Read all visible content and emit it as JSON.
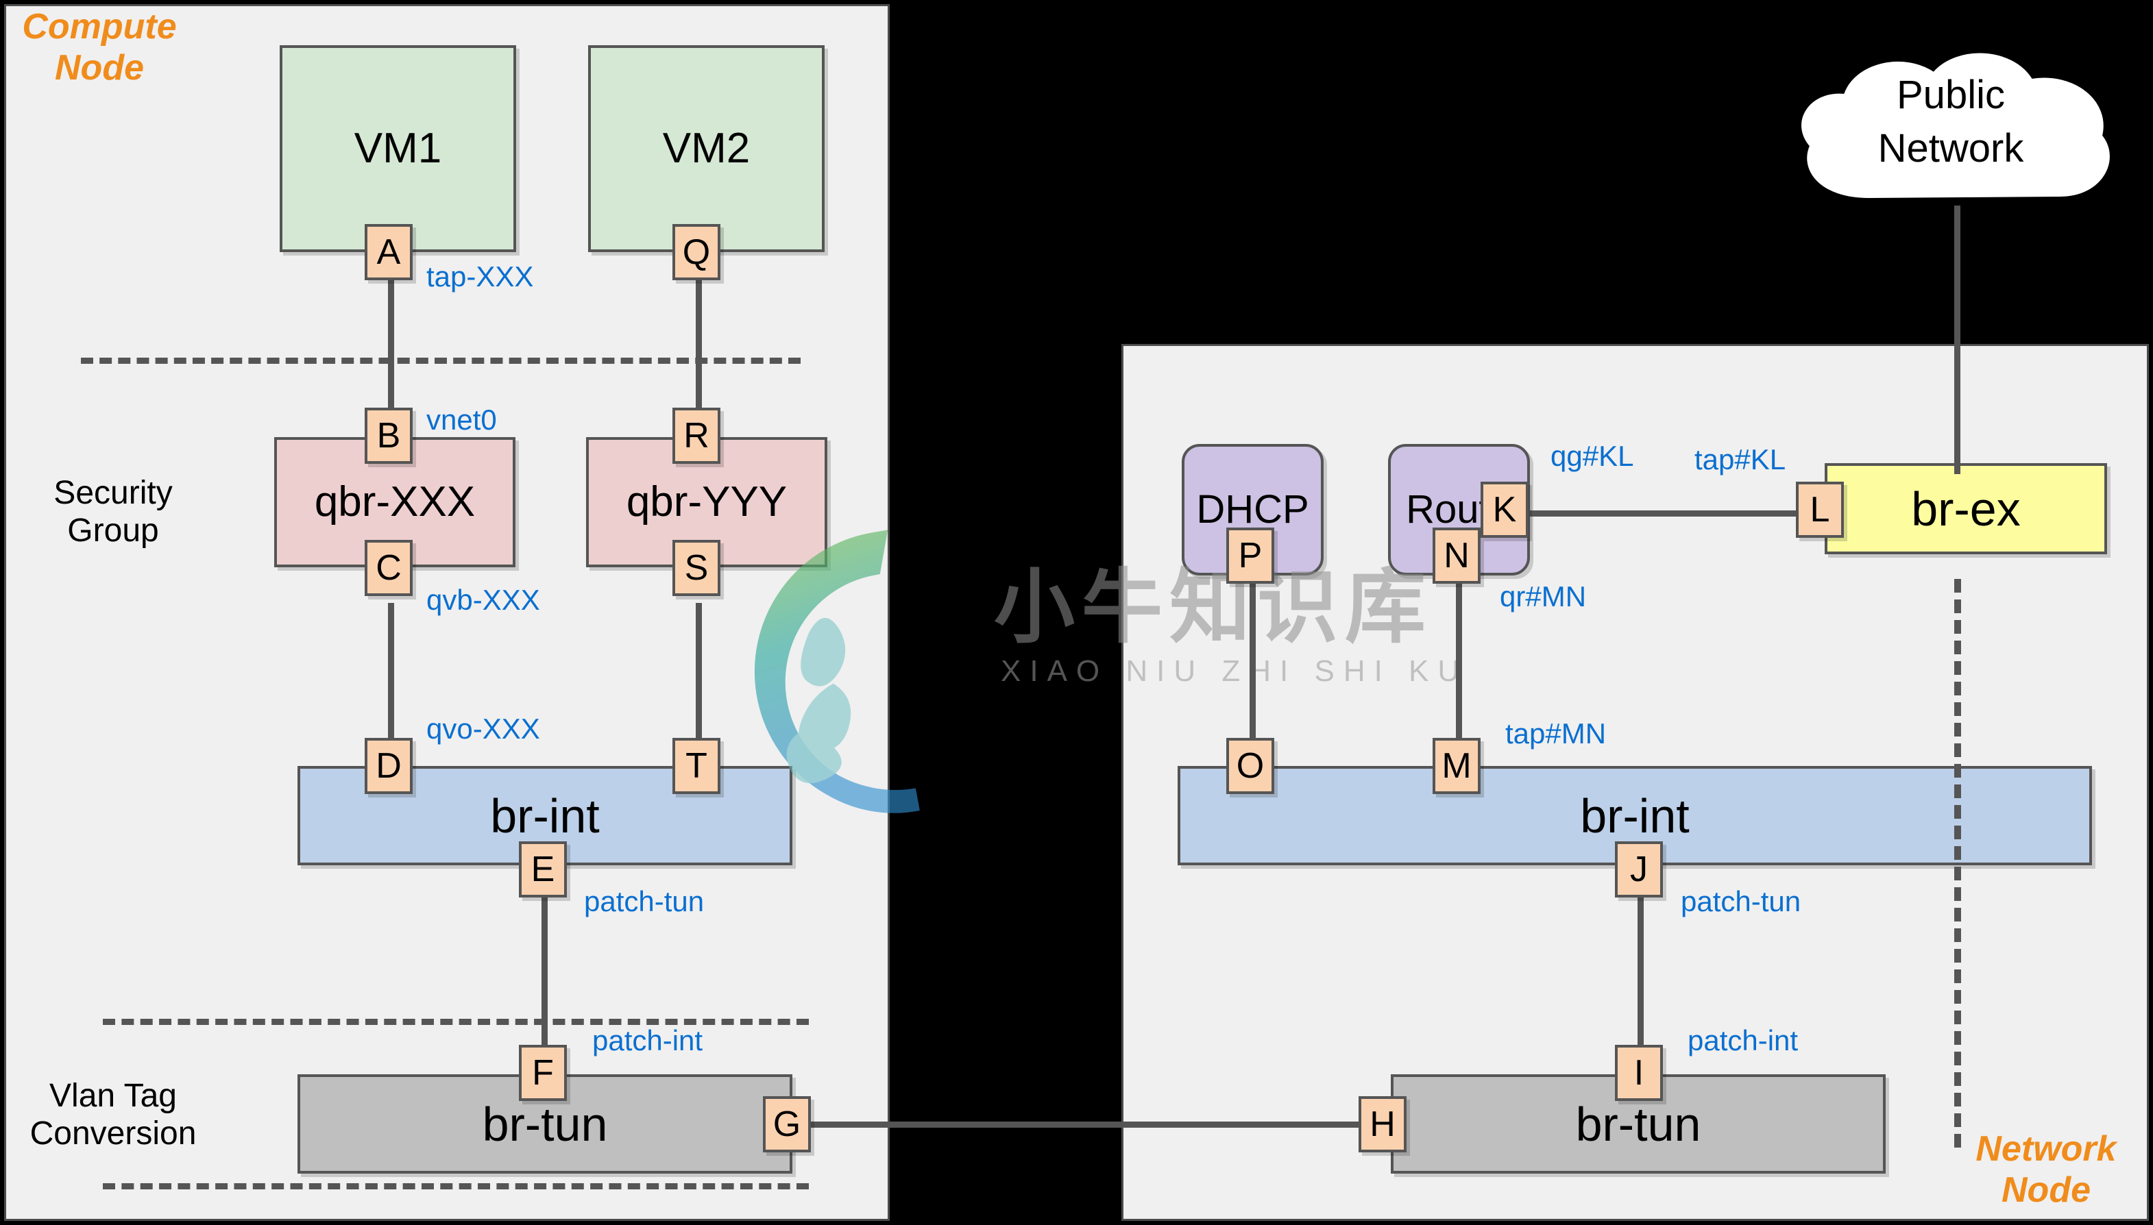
{
  "nodes": {
    "compute_title": "Compute\nNode",
    "compute_title_line1": "Compute",
    "compute_title_line2": "Node",
    "network_title_line1": "Network",
    "network_title_line2": "Node"
  },
  "zones": {
    "security_group_line1": "Security",
    "security_group_line2": "Group",
    "vlan_line1": "Vlan Tag",
    "vlan_line2": "Conversion"
  },
  "compute": {
    "vm1": "VM1",
    "vm2": "VM2",
    "qbr_xxx": "qbr-XXX",
    "qbr_yyy": "qbr-YYY",
    "br_int": "br-int",
    "br_tun": "br-tun",
    "ports": {
      "a": "A",
      "b": "B",
      "c": "C",
      "d": "D",
      "e": "E",
      "f": "F",
      "g": "G",
      "q": "Q",
      "r": "R",
      "s": "S",
      "t": "T"
    },
    "interfaces": {
      "tap_xxx": "tap-XXX",
      "vnet0": "vnet0",
      "qvb_xxx": "qvb-XXX",
      "qvo_xxx": "qvo-XXX",
      "patch_tun": "patch-tun",
      "patch_int": "patch-int"
    }
  },
  "network": {
    "dhcp": "DHCP",
    "router": "Route",
    "br_int": "br-int",
    "br_tun": "br-tun",
    "br_ex": "br-ex",
    "ports": {
      "h": "H",
      "i": "I",
      "j": "J",
      "k": "K",
      "l": "L",
      "m": "M",
      "n": "N",
      "o": "O",
      "p": "P"
    },
    "interfaces": {
      "qg_kl": "qg#KL",
      "tap_kl": "tap#KL",
      "qr_mn": "qr#MN",
      "tap_mn": "tap#MN",
      "patch_tun": "patch-tun",
      "patch_int": "patch-int"
    }
  },
  "public": {
    "line1": "Public",
    "line2": "Network"
  },
  "watermark": {
    "chinese": "小牛知识库",
    "pinyin": "XIAO NIU ZHI SHI KU"
  },
  "colors": {
    "vm": "#d5e8d4",
    "qbr": "#eecfcf",
    "br_int": "#bdd0e9",
    "br_tun": "#bfbfbf",
    "br_ex": "#fdfda0",
    "namespace": "#cdc2e3",
    "port": "#fbd2b0",
    "interface_label": "#0a6fd0",
    "node_title": "#f08c1c",
    "panel_bg": "#f0f0f0",
    "outer_bg": "#000000",
    "stroke": "#555555"
  }
}
